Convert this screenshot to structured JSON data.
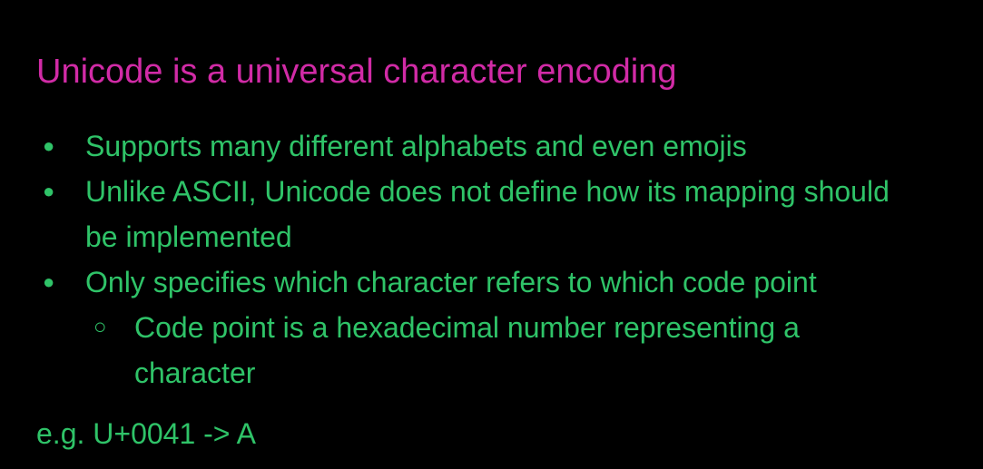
{
  "slide": {
    "title": "Unicode is a universal character encoding",
    "title_color": "#d12ba6",
    "text_color": "#2fc368",
    "background": "#000000",
    "bullets": [
      {
        "level": 1,
        "marker": "●",
        "text": "Supports many different alphabets and even emojis"
      },
      {
        "level": 1,
        "marker": "●",
        "text": "Unlike ASCII, Unicode does not define how its mapping should be implemented"
      },
      {
        "level": 1,
        "marker": "●",
        "text": "Only specifies which character refers to which code point"
      },
      {
        "level": 2,
        "marker": "○",
        "text": "Code point is a hexadecimal number representing a character"
      }
    ],
    "example": "e.g. U+0041 -> A"
  }
}
